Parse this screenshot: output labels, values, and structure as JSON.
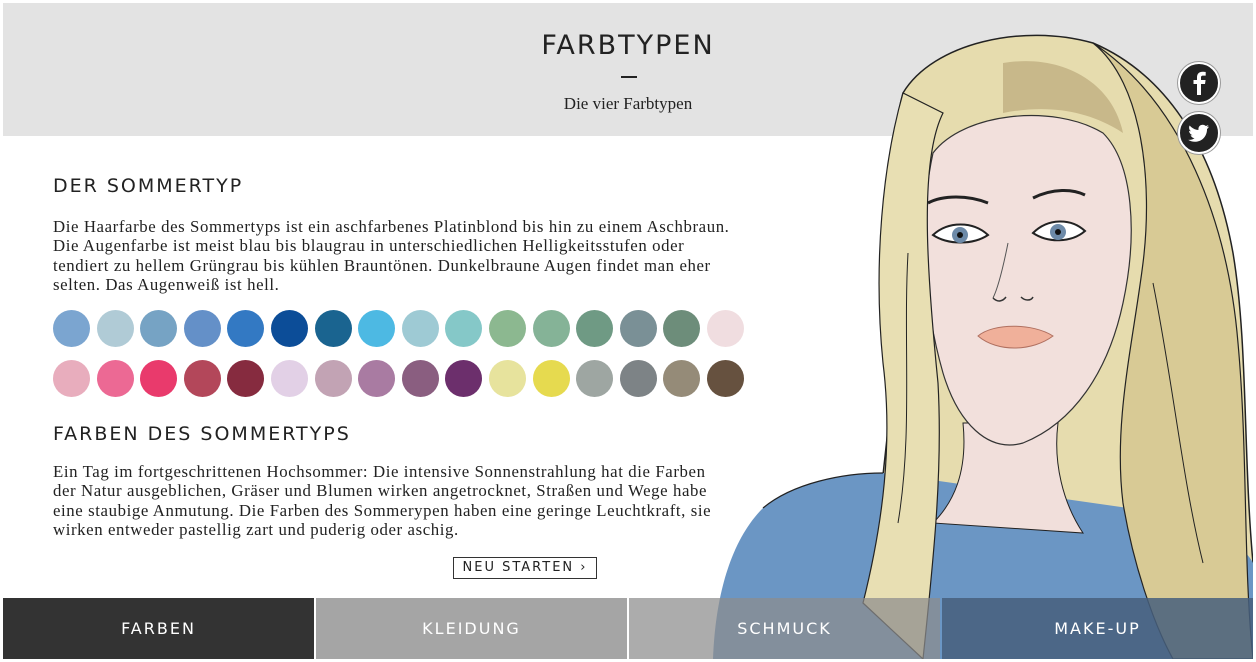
{
  "header": {
    "title": "FARBTYPEN",
    "subtitle": "Die vier Farbtypen"
  },
  "section1": {
    "heading": "DER SOMMERTYP",
    "text": "Die Haarfarbe des Sommertyps ist ein aschfarbenes Platinblond bis hin zu einem Aschbraun. Die Augenfarbe ist meist blau bis blaugrau in unterschiedlichen Helligkeitsstufen oder tendiert zu hellem Grüngrau bis kühlen Brauntönen. Dunkelbraune Augen findet man eher selten. Das Augenweiß ist hell."
  },
  "palette": {
    "row1": [
      "#7ba5d0",
      "#b0cbd6",
      "#76a3c4",
      "#6490c8",
      "#3379c3",
      "#0c4d98",
      "#1a6490",
      "#4db9e3",
      "#9ecad4",
      "#85c8c8",
      "#8cb890",
      "#85b397",
      "#6f9a84",
      "#7a9096",
      "#6d8d7a",
      "#f0dde0"
    ],
    "row2": [
      "#e8adbd",
      "#ec6994",
      "#e93a6c",
      "#b3475a",
      "#862b3f",
      "#e2d0e6",
      "#c2a3b4",
      "#a97ba2",
      "#8a5e80",
      "#6c2f6c",
      "#e7e39d",
      "#e6da4f",
      "#9ea6a2",
      "#7d8386",
      "#958b78",
      "#66513f"
    ]
  },
  "section2": {
    "heading": "FARBEN DES SOMMERTYPS",
    "text": "Ein Tag im fortgeschrittenen Hochsommer: Die intensive Sonnenstrahlung hat die Farben der Natur ausgeblichen, Gräser und Blumen wirken angetrocknet, Straßen und Wege habe eine staubige Anmutung. Die Farben des Sommerypen haben eine geringe Leuchtkraft, sie wirken entweder pastellig zart und puderig oder aschig."
  },
  "restart_label": "NEU STARTEN ›",
  "social": {
    "facebook": "facebook-icon",
    "twitter": "twitter-icon"
  },
  "tabs": [
    "FARBEN",
    "KLEIDUNG",
    "SCHMUCK",
    "MAKE-UP"
  ],
  "active_tab": "FARBEN"
}
